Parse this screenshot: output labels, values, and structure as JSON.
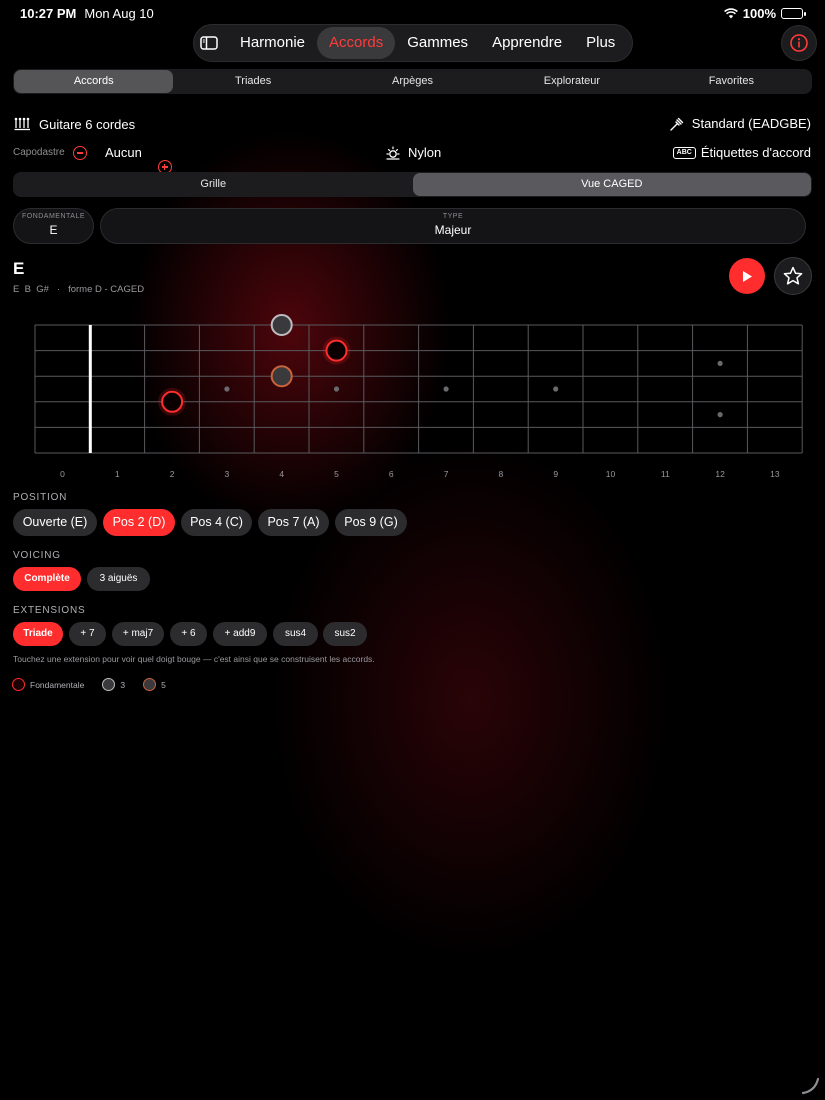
{
  "status": {
    "time": "10:27 PM",
    "date": "Mon Aug 10",
    "battery": "100%",
    "battery_level": 1.0
  },
  "topnav": {
    "tabs": [
      {
        "label": "Harmonie"
      },
      {
        "label": "Accords"
      },
      {
        "label": "Gammes"
      },
      {
        "label": "Apprendre"
      },
      {
        "label": "Plus"
      }
    ],
    "active_index": 1
  },
  "subtabs": {
    "items": [
      "Accords",
      "Triades",
      "Arpèges",
      "Explorateur",
      "Favorites"
    ],
    "active_index": 0
  },
  "instrument": {
    "name": "Guitare 6 cordes",
    "tuning": "Standard (EADGBE)",
    "capo_label": "Capodastre",
    "capo_value": "Aucun",
    "string_type": "Nylon",
    "chord_labels": "Étiquettes d'accord",
    "chord_labels_icon_text": "ABC"
  },
  "view": {
    "items": [
      "Grille",
      "Vue CAGED"
    ],
    "active_index": 1
  },
  "picker": {
    "root_label": "FONDAMENTALE",
    "root_value": "E",
    "type_label": "TYPE",
    "type_value": "Majeur"
  },
  "chord": {
    "name": "E",
    "notes": "E  B  G#",
    "separator": "·",
    "shape": "forme D - CAGED"
  },
  "fretboard": {
    "frets": [
      "0",
      "1",
      "2",
      "3",
      "4",
      "5",
      "6",
      "7",
      "8",
      "9",
      "10",
      "11",
      "12",
      "13"
    ],
    "strings": 6,
    "nut_fret": 0,
    "inlay_single": [
      3,
      5,
      7,
      9
    ],
    "inlay_double": [
      12
    ],
    "notes": [
      {
        "fret": 4,
        "string": 1,
        "role": "third"
      },
      {
        "fret": 5,
        "string": 2,
        "role": "root"
      },
      {
        "fret": 4,
        "string": 3,
        "role": "fifth"
      },
      {
        "fret": 2,
        "string": 4,
        "role": "root"
      }
    ],
    "colors": {
      "root": "#ff2d2d",
      "third": "#8e8e93",
      "fifth": "#c8643c"
    }
  },
  "position": {
    "label": "POSITION",
    "options": [
      "Ouverte (E)",
      "Pos 2 (D)",
      "Pos 4 (C)",
      "Pos 7 (A)",
      "Pos 9 (G)"
    ],
    "active_index": 1
  },
  "voicing": {
    "label": "VOICING",
    "options": [
      "Complète",
      "3 aiguës"
    ],
    "active_index": 0
  },
  "extensions": {
    "label": "EXTENSIONS",
    "options": [
      "Triade",
      "+ 7",
      "+ maj7",
      "+ 6",
      "+ add9",
      "sus4",
      "sus2"
    ],
    "active_index": 0,
    "hint": "Touchez une extension pour voir quel doigt bouge — c'est ainsi que se construisent les accords."
  },
  "legend": {
    "root": "Fondamentale",
    "third": "3",
    "fifth": "5"
  }
}
